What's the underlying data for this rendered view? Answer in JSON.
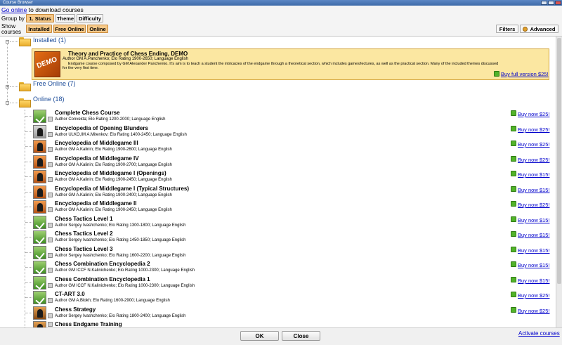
{
  "window": {
    "title": "Course Browser"
  },
  "top": {
    "go_online": "Go online",
    "go_online_suffix": "to download courses"
  },
  "group_by": {
    "label": "Group by",
    "buttons": [
      "1. Status",
      "Theme",
      "Difficulty"
    ]
  },
  "show_courses": {
    "label_1": "Show",
    "label_2": "courses",
    "buttons": [
      "Installed",
      "Free Online",
      "Online"
    ]
  },
  "right_buttons": {
    "filters": "Filters",
    "advanced": "Advanced"
  },
  "groups": {
    "installed": "Installed (1)",
    "free_online": "Free Online (7)",
    "online": "Online (18)"
  },
  "demo": {
    "title": "Theory and Practice of Chess Ending, DEMO",
    "meta": "Author GM A.Panchenko; Elo Rating 1900-2650; Language English",
    "desc_1": "Endgame course composed by GM Alexander Panchenko. It's aim is to teach a student the intricacies of the endgame through a theoretical section, which includes games/lectures, as well as the practical section. Many of the included themes discussed",
    "desc_2": "for the very first time.",
    "buy": "Buy full version $25!",
    "icon_text": "DEMO"
  },
  "courses": [
    {
      "title": "Complete Chess Course",
      "meta": "Author Convekta; Elo Rating 1200-2000; Language English",
      "buy": "Buy now $25!",
      "icon": "green"
    },
    {
      "title": "Encyclopedia of Opening Blunders",
      "meta": "Author ULKO,IM A.Mitenkov; Elo Rating 1400-2450; Language English",
      "buy": "Buy now $25!",
      "icon": "gray"
    },
    {
      "title": "Encyclopedia of Middlegame III",
      "meta": "Author GM A.Kalinin; Elo Rating 1900-2600; Language English",
      "buy": "Buy now $25!",
      "icon": "orange"
    },
    {
      "title": "Encyclopedia of Middlegame IV",
      "meta": "Author GM A.Kalinin; Elo Rating 1900-2700; Language English",
      "buy": "Buy now $25!",
      "icon": "orange"
    },
    {
      "title": "Encyclopedia of Middlegame I (Openings)",
      "meta": "Author GM A.Kalinin; Elo Rating 1900-2450; Language English",
      "buy": "Buy now $15!",
      "icon": "orange"
    },
    {
      "title": "Encyclopedia of Middlegame I (Typical Structures)",
      "meta": "Author GM A.Kalinin; Elo Rating 1900-2400; Language English",
      "buy": "Buy now $15!",
      "icon": "orange"
    },
    {
      "title": "Encyclopedia of Middlegame II",
      "meta": "Author GM A.Kalinin; Elo Rating 1900-2450; Language English",
      "buy": "Buy now $25!",
      "icon": "orange"
    },
    {
      "title": "Chess Tactics Level 1",
      "meta": "Author Sergey Ivashchenko; Elo Rating 1300-1800; Language English",
      "buy": "Buy now $15!",
      "icon": "green"
    },
    {
      "title": "Chess Tactics Level 2",
      "meta": "Author Sergey Ivashchenko; Elo Rating 1450-1850; Language English",
      "buy": "Buy now $15!",
      "icon": "green"
    },
    {
      "title": "Chess Tactics Level 3",
      "meta": "Author Sergey Ivashchenko; Elo Rating 1600-2200; Language English",
      "buy": "Buy now $15!",
      "icon": "green"
    },
    {
      "title": "Chess Combination Encyclopedia 2",
      "meta": "Author GM ICCF N.Kalinichenko; Elo Rating 1000-2300; Language English",
      "buy": "Buy now $15!",
      "icon": "green"
    },
    {
      "title": "Chess Combination Encyclopedia 1",
      "meta": "Author GM ICCF N.Kalinichenko; Elo Rating 1000-2300; Language English",
      "buy": "Buy now $15!",
      "icon": "green"
    },
    {
      "title": "CT-ART 3.0",
      "meta": "Author GM A.Blokh; Elo Rating 1600-2900; Language English",
      "buy": "Buy now $25!",
      "icon": "green"
    },
    {
      "title": "Chess Strategy",
      "meta": "Author Sergey Ivashchenko; Elo Rating 1800-2400; Language English",
      "buy": "Buy now $25!",
      "icon": "chess"
    },
    {
      "title": "Chess Endgame Training",
      "meta": "",
      "buy": "",
      "icon": "chess"
    }
  ],
  "bottom": {
    "ok": "OK",
    "close": "Close",
    "activate": "Activate courses"
  }
}
